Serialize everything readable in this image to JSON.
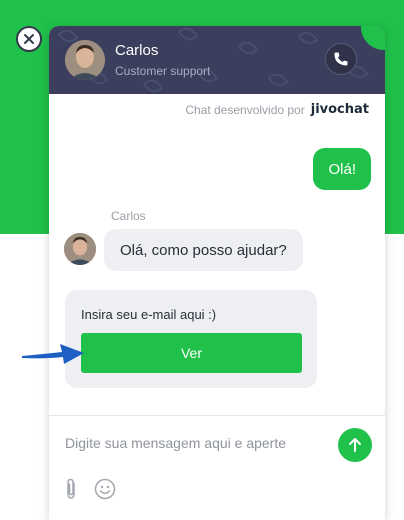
{
  "header": {
    "agent_name": "Carlos",
    "agent_role": "Customer support"
  },
  "credit": {
    "text": "Chat desenvolvido por",
    "brand": "jivochat"
  },
  "messages": {
    "outgoing": "Olá!",
    "sender": "Carlos",
    "incoming": "Olá, como posso ajudar?"
  },
  "email_card": {
    "prompt": "Insira seu e-mail aqui :)",
    "button_label": "Ver"
  },
  "composer": {
    "placeholder": "Digite sua mensagem aqui e aperte"
  },
  "icons": {
    "close": "close-icon",
    "phone": "phone-icon",
    "send": "arrow-up-icon",
    "attach": "paperclip-icon",
    "emoji": "smiley-icon",
    "pointer": "blue-arrow-icon"
  },
  "colors": {
    "brand_green": "#1fc14a",
    "header_bg": "#3b3e5c",
    "bubble_gray": "#eeeff2",
    "pointer_blue": "#1e5fc4"
  }
}
